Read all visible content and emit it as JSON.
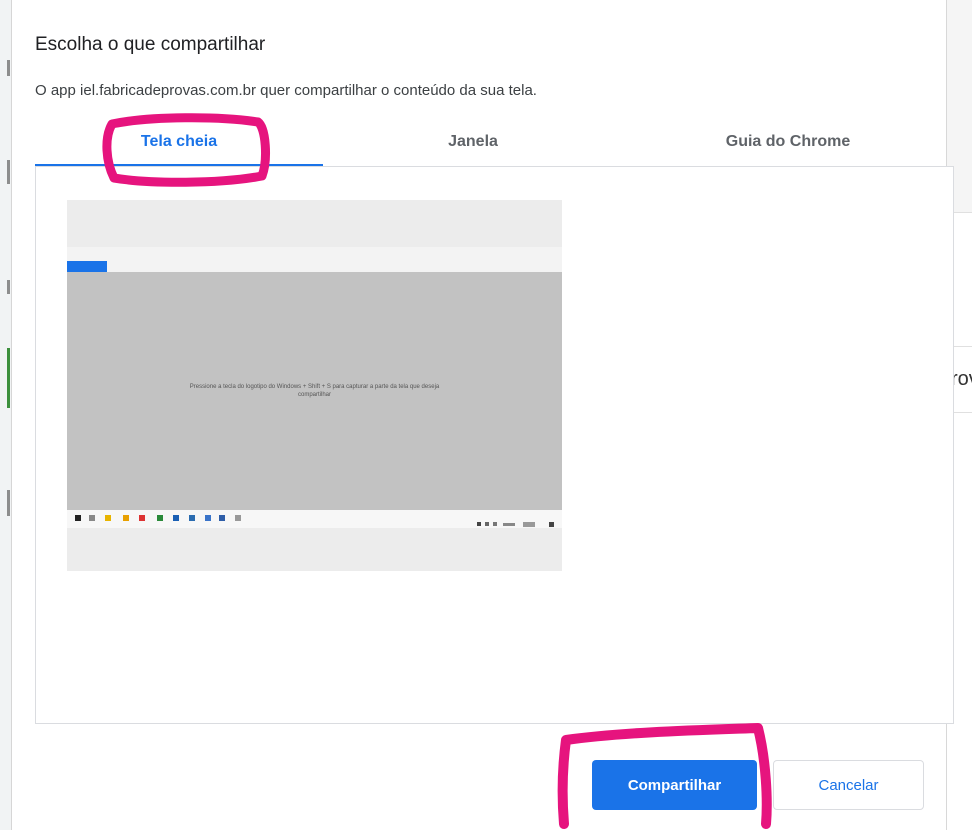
{
  "dialog": {
    "title": "Escolha o que compartilhar",
    "description": "O app iel.fabricadeprovas.com.br quer compartilhar o conteúdo da sua tela."
  },
  "tabs": [
    {
      "label": "Tela cheia",
      "active": true
    },
    {
      "label": "Janela",
      "active": false
    },
    {
      "label": "Guia do Chrome",
      "active": false
    }
  ],
  "preview": {
    "message_line1": "Pressione a tecla do logotipo do Windows + Shift + S para capturar a parte da tela que deseja",
    "message_line2": "compartilhar"
  },
  "buttons": {
    "share": "Compartilhar",
    "cancel": "Cancelar"
  },
  "background": {
    "right_fragment": "rov"
  },
  "colors": {
    "accent": "#1a73e8",
    "highlight": "#e6147e"
  },
  "icons": [
    "screen-preview-icon",
    "taskbar-app-icon"
  ]
}
